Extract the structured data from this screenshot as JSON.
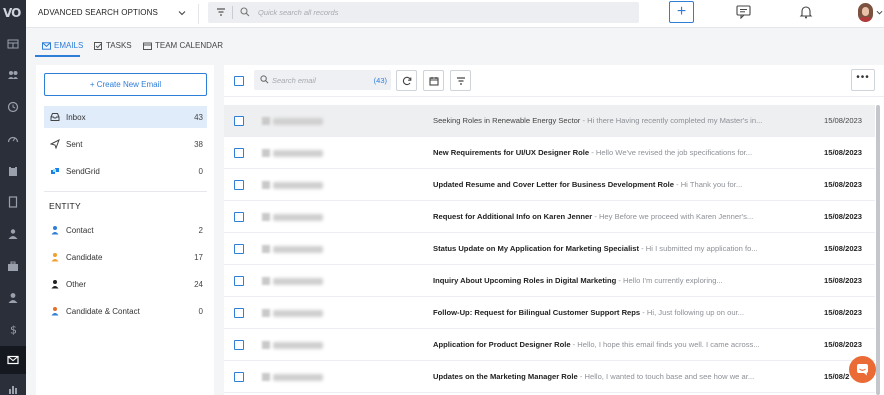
{
  "app": {
    "logo_text": "VO",
    "accent": "#2f7ed8",
    "rail_bg": "#2b2f3a",
    "rail_icons": [
      "dashboard-icon",
      "people-group-icon",
      "history-icon",
      "speedometer-icon",
      "clipboard-icon",
      "document-icon",
      "user-tree-icon",
      "briefcase-icon",
      "person-icon",
      "dollar-icon",
      "envelope-icon",
      "chart-icon"
    ]
  },
  "topbar": {
    "advanced_search": "ADVANCED SEARCH OPTIONS",
    "quick_search_placeholder": "Quick search all records",
    "add_label": "+"
  },
  "tabs": [
    {
      "label": "EMAILS",
      "icon": "envelope-icon",
      "active": true
    },
    {
      "label": "TASKS",
      "icon": "checkbox-icon",
      "active": false
    },
    {
      "label": "TEAM CALENDAR",
      "icon": "calendar-icon",
      "active": false
    }
  ],
  "sidebar": {
    "create_button": "+ Create New Email",
    "folders": [
      {
        "label": "Inbox",
        "count": "43",
        "icon": "inbox-icon",
        "selected": true
      },
      {
        "label": "Sent",
        "count": "38",
        "icon": "paper-plane-icon",
        "selected": false
      },
      {
        "label": "SendGrid",
        "count": "0",
        "icon": "sendgrid-icon",
        "selected": false
      }
    ],
    "entity_heading": "ENTITY",
    "entities": [
      {
        "label": "Contact",
        "count": "2",
        "icon": "contact-person-icon",
        "color": "#2f7ed8"
      },
      {
        "label": "Candidate",
        "count": "17",
        "icon": "candidate-person-icon",
        "color": "#f0a030"
      },
      {
        "label": "Other",
        "count": "24",
        "icon": "other-person-icon",
        "color": "#222222"
      },
      {
        "label": "Candidate & Contact",
        "count": "0",
        "icon": "candidate-contact-person-icon",
        "color": "#e0702a"
      }
    ]
  },
  "list": {
    "search_placeholder": "Search email",
    "count_badge": "(43)",
    "more_label": "•••",
    "rows": [
      {
        "subject": "Seeking Roles in Renewable Energy Sector",
        "preview": " - Hi there Having recently completed my Master's in...",
        "date": "15/08/2023",
        "read": true
      },
      {
        "subject": "New Requirements for UI/UX Designer Role",
        "preview": " - Hello We've revised the job specifications for...",
        "date": "15/08/2023",
        "read": false
      },
      {
        "subject": "Updated Resume and Cover Letter for Business Development Role",
        "preview": " - Hi Thank you for...",
        "date": "15/08/2023",
        "read": false
      },
      {
        "subject": "Request for Additional Info on Karen Jenner",
        "preview": " - Hey Before we proceed with Karen Jenner's...",
        "date": "15/08/2023",
        "read": false
      },
      {
        "subject": "Status Update on My Application for Marketing Specialist",
        "preview": " - Hi I submitted my application fo...",
        "date": "15/08/2023",
        "read": false
      },
      {
        "subject": "Inquiry About Upcoming Roles in Digital Marketing",
        "preview": " - Hello I'm currently exploring...",
        "date": "15/08/2023",
        "read": false
      },
      {
        "subject": "Follow-Up: Request for Bilingual Customer Support Reps",
        "preview": " - Hi, Just following up on our...",
        "date": "15/08/2023",
        "read": false
      },
      {
        "subject": "Application for Product Designer Role",
        "preview": " - Hello, I hope this email finds you well. I came across...",
        "date": "15/08/2023",
        "read": false
      },
      {
        "subject": "Updates on the Marketing Manager Role",
        "preview": " - Hello, I wanted to touch base and see how we ar...",
        "date": "15/08/2",
        "read": false
      }
    ]
  }
}
